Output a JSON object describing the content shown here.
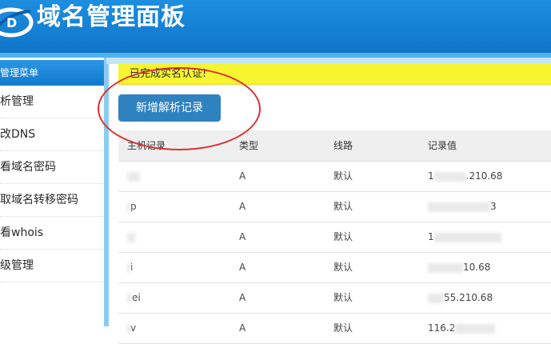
{
  "header": {
    "title": "域名管理面板"
  },
  "sidebar": {
    "title": "管理菜单",
    "items": [
      {
        "label": "析管理"
      },
      {
        "label": "改DNS"
      },
      {
        "label": "看域名密码"
      },
      {
        "label": "取域名转移密码"
      },
      {
        "label": "看whois"
      },
      {
        "label": "级管理"
      }
    ]
  },
  "notice": {
    "text": "已完成实名认证!"
  },
  "actions": {
    "add_record_label": "新增解析记录"
  },
  "table": {
    "headers": {
      "host": "主机记录",
      "type": "类型",
      "line": "线路",
      "value": "记录值"
    },
    "rows": [
      {
        "host": "",
        "type": "A",
        "line": "默认",
        "value_prefix": "1",
        "value_suffix": ".210.68"
      },
      {
        "host": "p",
        "type": "A",
        "line": "默认",
        "value_prefix": "",
        "value_suffix": "3"
      },
      {
        "host": "",
        "type": "A",
        "line": "默认",
        "value_prefix": "1",
        "value_suffix": ""
      },
      {
        "host": "i",
        "type": "A",
        "line": "默认",
        "value_prefix": "",
        "value_suffix": "10.68"
      },
      {
        "host": "ei",
        "type": "A",
        "line": "默认",
        "value_prefix": "",
        "value_suffix": "55.210.68"
      },
      {
        "host": "v",
        "type": "A",
        "line": "默认",
        "value_prefix": "116.2",
        "value_suffix": ""
      }
    ]
  },
  "colors": {
    "header_blue": "#1480d4",
    "notice_yellow": "#f7f430",
    "button_blue": "#2f82c0",
    "annotation_red": "#d93030"
  }
}
